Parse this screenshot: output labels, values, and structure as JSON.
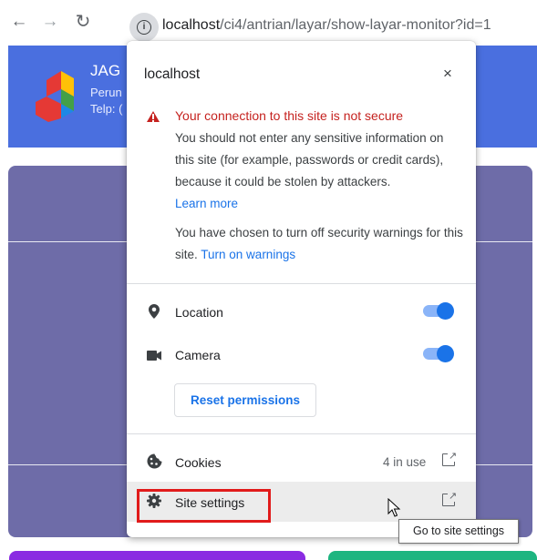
{
  "browser": {
    "url_host": "localhost",
    "url_path": "/ci4/antrian/layar/show-layar-monitor?id=1",
    "back_icon": "arrow-left-icon",
    "forward_icon": "arrow-right-icon",
    "reload_icon": "reload-icon",
    "info_icon": "info-icon"
  },
  "page": {
    "brand_name": "JAG",
    "brand_line1": "Perun",
    "brand_line2": "Telp: (",
    "header_color": "#4a6fdf",
    "panel_color": "#6e6ca8"
  },
  "popup": {
    "title": "localhost",
    "close_label": "×",
    "warning_title": "Your connection to this site is not secure",
    "warning_body": "You should not enter any sensitive information on this site (for example, passwords or credit cards), because it could be stolen by attackers.",
    "learn_more": "Learn more",
    "turned_off_text": "You have chosen to turn off security warnings for this site.",
    "turn_on_warnings": "Turn on warnings",
    "permissions": [
      {
        "label": "Location",
        "icon": "location-pin-icon",
        "enabled": true
      },
      {
        "label": "Camera",
        "icon": "camera-icon",
        "enabled": true
      }
    ],
    "reset_permissions": "Reset permissions",
    "cookies_label": "Cookies",
    "cookies_count": "4 in use",
    "site_settings_label": "Site settings",
    "accent_color": "#1a73e8",
    "warning_color": "#c5221f"
  },
  "tooltip": {
    "text": "Go to site settings"
  }
}
